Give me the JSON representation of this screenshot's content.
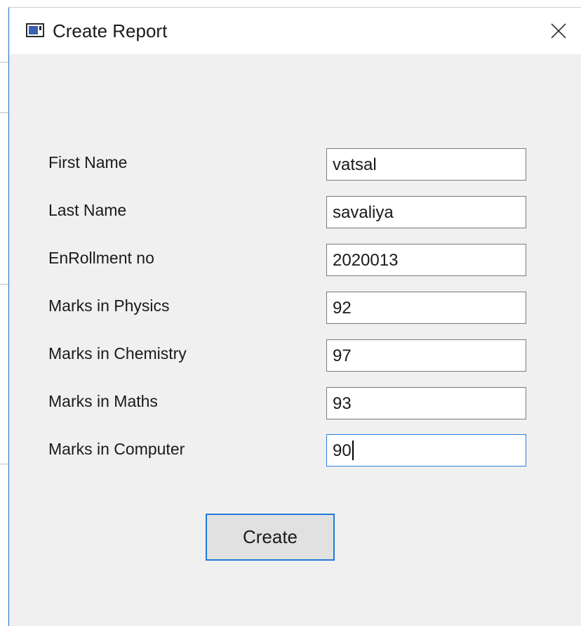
{
  "window": {
    "title": "Create Report",
    "accent_color": "#1f7ad8",
    "icons": {
      "app": "app-window-icon",
      "close": "close-icon"
    }
  },
  "form": {
    "fields": [
      {
        "label": "First Name",
        "value": "vatsal"
      },
      {
        "label": "Last Name",
        "value": "savaliya"
      },
      {
        "label": "EnRollment no",
        "value": "2020013"
      },
      {
        "label": "Marks in Physics",
        "value": "92"
      },
      {
        "label": "Marks in Chemistry",
        "value": "97"
      },
      {
        "label": "Marks in Maths",
        "value": "93"
      },
      {
        "label": "Marks in Computer",
        "value": "90"
      }
    ]
  },
  "actions": {
    "create_label": "Create"
  }
}
